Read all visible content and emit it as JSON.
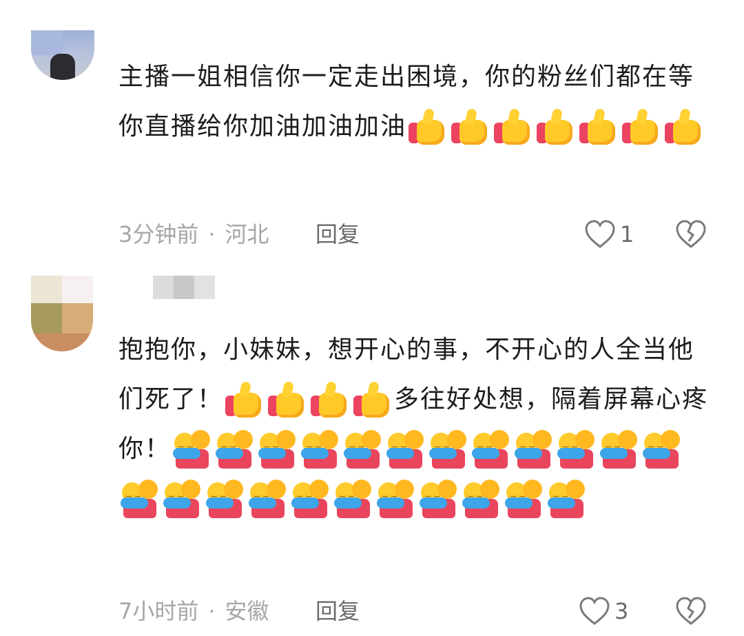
{
  "comments": [
    {
      "text_parts": [
        {
          "t": "text",
          "v": "主播一姐相信你一定走出困境，你的粉丝们都在等你直播给你加油加油加油"
        },
        {
          "t": "emoji",
          "icon": "thumbs-up-icon",
          "count": 7
        }
      ],
      "time": "3分钟前",
      "location": "河北",
      "reply_label": "回复",
      "likes": "1"
    },
    {
      "text_parts": [
        {
          "t": "text",
          "v": "抱抱你，小妹妹，想开心的事，不开心的人全当他们死了！"
        },
        {
          "t": "emoji",
          "icon": "thumbs-up-icon",
          "count": 4
        },
        {
          "t": "text",
          "v": "多往好处想，隔着屏幕心疼你！"
        },
        {
          "t": "emoji",
          "icon": "hug-icon",
          "count": 23
        }
      ],
      "time": "7小时前",
      "location": "安徽",
      "reply_label": "回复",
      "likes": "3"
    }
  ],
  "icons": {
    "like": "heart-outline-icon",
    "dislike": "broken-heart-icon"
  },
  "colors": {
    "meta_gray": "#a6a6a6",
    "reply_gray": "#6a6a6a",
    "text": "#1c1c1c"
  }
}
